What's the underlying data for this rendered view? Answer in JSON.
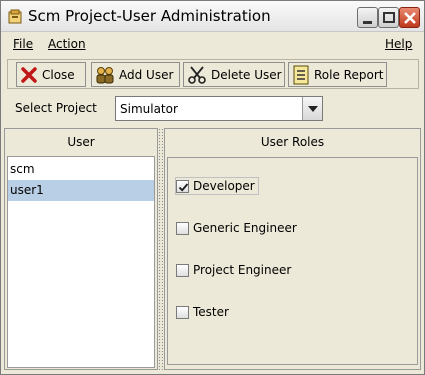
{
  "window": {
    "title": "Scm Project-User Administration"
  },
  "menu": {
    "file": "File",
    "action": "Action",
    "help": "Help"
  },
  "toolbar": {
    "close_label": "Close",
    "add_user_label": "Add User",
    "delete_user_label": "Delete User",
    "role_report_label": "Role Report"
  },
  "project": {
    "label": "Select Project",
    "selected": "Simulator"
  },
  "users": {
    "header": "User",
    "items": [
      {
        "name": "scm",
        "selected": false
      },
      {
        "name": "user1",
        "selected": true
      }
    ]
  },
  "roles": {
    "header": "User Roles",
    "items": [
      {
        "label": "Developer",
        "checked": true
      },
      {
        "label": "Generic Engineer",
        "checked": false
      },
      {
        "label": "Project Engineer",
        "checked": false
      },
      {
        "label": "Tester",
        "checked": false
      }
    ]
  },
  "colors": {
    "selection": "#b8cfe5",
    "background": "#ece9d8",
    "close_button": "#c0391b"
  }
}
